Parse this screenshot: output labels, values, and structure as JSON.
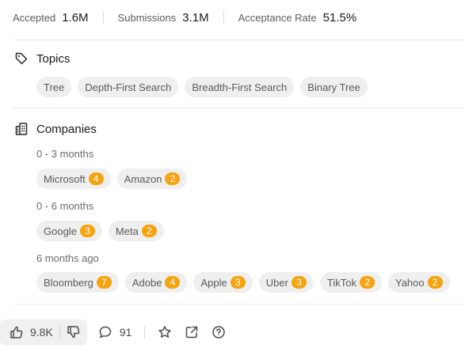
{
  "stats": [
    {
      "label": "Accepted",
      "value": "1.6M"
    },
    {
      "label": "Submissions",
      "value": "3.1M"
    },
    {
      "label": "Acceptance Rate",
      "value": "51.5%"
    }
  ],
  "topics": {
    "title": "Topics",
    "items": [
      "Tree",
      "Depth-First Search",
      "Breadth-First Search",
      "Binary Tree"
    ]
  },
  "companies": {
    "title": "Companies",
    "groups": [
      {
        "label": "0 - 3 months",
        "items": [
          {
            "name": "Microsoft",
            "count": "4"
          },
          {
            "name": "Amazon",
            "count": "2"
          }
        ]
      },
      {
        "label": "0 - 6 months",
        "items": [
          {
            "name": "Google",
            "count": "3"
          },
          {
            "name": "Meta",
            "count": "2"
          }
        ]
      },
      {
        "label": "6 months ago",
        "items": [
          {
            "name": "Bloomberg",
            "count": "7"
          },
          {
            "name": "Adobe",
            "count": "4"
          },
          {
            "name": "Apple",
            "count": "3"
          },
          {
            "name": "Uber",
            "count": "3"
          },
          {
            "name": "TikTok",
            "count": "2"
          },
          {
            "name": "Yahoo",
            "count": "2"
          }
        ]
      }
    ]
  },
  "actions": {
    "likes": "9.8K",
    "comments": "91"
  },
  "colors": {
    "badge": "#f5a30f",
    "chip_bg": "#efefef"
  }
}
